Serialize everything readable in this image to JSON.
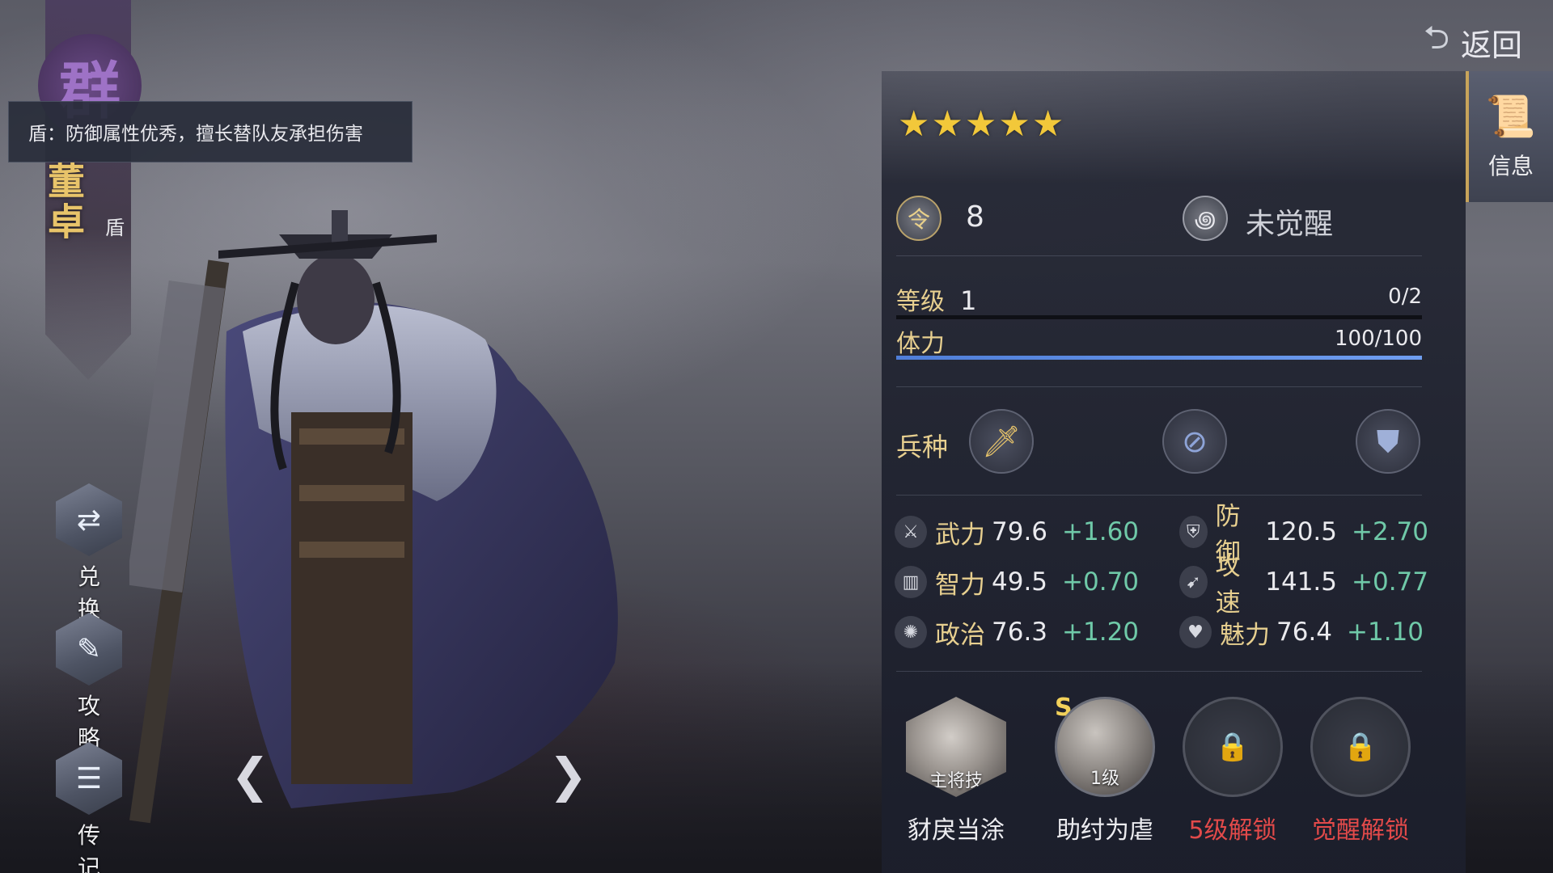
{
  "hero": {
    "faction": "群",
    "name": "董卓",
    "role": "盾",
    "tooltip": "盾：防御属性优秀，擅长替队友承担伤害"
  },
  "side_menu": [
    {
      "label": "兑换",
      "icon": "exchange-icon"
    },
    {
      "label": "攻略",
      "icon": "guide-scroll-icon"
    },
    {
      "label": "传记",
      "icon": "biography-book-icon"
    }
  ],
  "nav": {
    "prev": "❮",
    "next": "❯"
  },
  "top": {
    "back_label": "返回",
    "info_tab_label": "信息"
  },
  "rating": {
    "stars": 5
  },
  "command": {
    "value": "8",
    "badge": "令"
  },
  "awaken": {
    "status": "未觉醒"
  },
  "level": {
    "label": "等级",
    "value": "1",
    "exp": "0/2",
    "progress": 0
  },
  "stamina": {
    "label": "体力",
    "value": "100/100",
    "progress": 1.0
  },
  "troops": {
    "label": "兵种",
    "types": [
      "sword-icon",
      "shield-round-icon",
      "armor-icon"
    ]
  },
  "stats": [
    {
      "name": "武力",
      "value": "79.6",
      "inc": "+1.60",
      "icon": "crossed-swords-icon"
    },
    {
      "name": "防御",
      "value": "120.5",
      "inc": "+2.70",
      "icon": "shield-icon"
    },
    {
      "name": "智力",
      "value": "49.5",
      "inc": "+0.70",
      "icon": "book-icon"
    },
    {
      "name": "攻速",
      "value": "141.5",
      "inc": "+0.77",
      "icon": "boot-icon"
    },
    {
      "name": "政治",
      "value": "76.3",
      "inc": "+1.20",
      "icon": "seal-icon"
    },
    {
      "name": "魅力",
      "value": "76.4",
      "inc": "+1.10",
      "icon": "heart-icon"
    }
  ],
  "skills": [
    {
      "name": "豺戾当涂",
      "tag": "主将技",
      "locked": false
    },
    {
      "name": "助纣为虐",
      "tag": "1级",
      "grade": "S",
      "locked": false
    },
    {
      "name": "5级解锁",
      "locked": true
    },
    {
      "name": "觉醒解锁",
      "locked": true
    }
  ],
  "colors": {
    "accent_gold": "#e7cf8f",
    "increment_green": "#6fc9a8",
    "lock_red": "#e24a4a",
    "star": "#f2c83a"
  }
}
